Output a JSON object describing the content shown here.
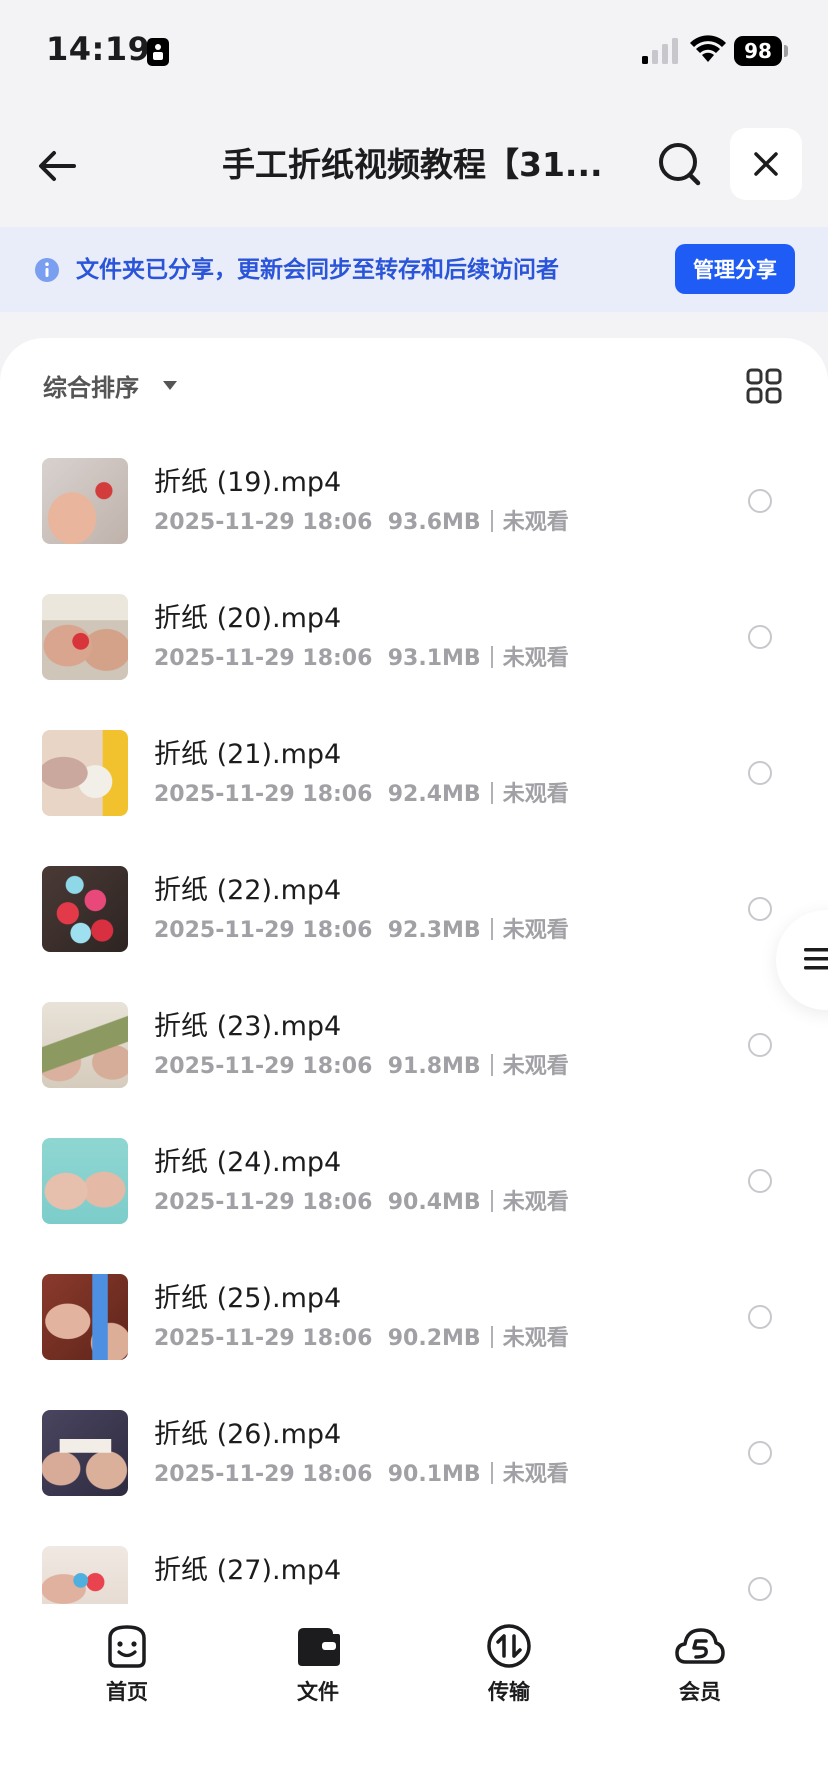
{
  "status": {
    "time": "14:19",
    "battery": "98"
  },
  "nav": {
    "title": "手工折纸视频教程【31..."
  },
  "banner": {
    "text": "文件夹已分享，更新会同步至转存和后续访问者",
    "button": "管理分享"
  },
  "sort": {
    "label": "综合排序"
  },
  "files": [
    {
      "name": "折纸 (19).mp4",
      "date": "2025-11-29 18:06",
      "size": "93.6MB",
      "status": "未观看"
    },
    {
      "name": "折纸 (20).mp4",
      "date": "2025-11-29 18:06",
      "size": "93.1MB",
      "status": "未观看"
    },
    {
      "name": "折纸 (21).mp4",
      "date": "2025-11-29 18:06",
      "size": "92.4MB",
      "status": "未观看"
    },
    {
      "name": "折纸 (22).mp4",
      "date": "2025-11-29 18:06",
      "size": "92.3MB",
      "status": "未观看"
    },
    {
      "name": "折纸 (23).mp4",
      "date": "2025-11-29 18:06",
      "size": "91.8MB",
      "status": "未观看"
    },
    {
      "name": "折纸 (24).mp4",
      "date": "2025-11-29 18:06",
      "size": "90.4MB",
      "status": "未观看"
    },
    {
      "name": "折纸 (25).mp4",
      "date": "2025-11-29 18:06",
      "size": "90.2MB",
      "status": "未观看"
    },
    {
      "name": "折纸 (26).mp4",
      "date": "2025-11-29 18:06",
      "size": "90.1MB",
      "status": "未观看"
    },
    {
      "name": "折纸 (27).mp4",
      "date": "",
      "size": "",
      "status": ""
    }
  ],
  "tabs": [
    {
      "label": "首页",
      "icon": "smile-face-icon"
    },
    {
      "label": "文件",
      "icon": "wallet-folder-icon"
    },
    {
      "label": "传输",
      "icon": "transfer-icon"
    },
    {
      "label": "会员",
      "icon": "cloud-vip-icon"
    }
  ],
  "colors": {
    "accent": "#1f5bf5",
    "banner_bg": "#e9ecf9",
    "banner_text": "#2a55d8"
  }
}
